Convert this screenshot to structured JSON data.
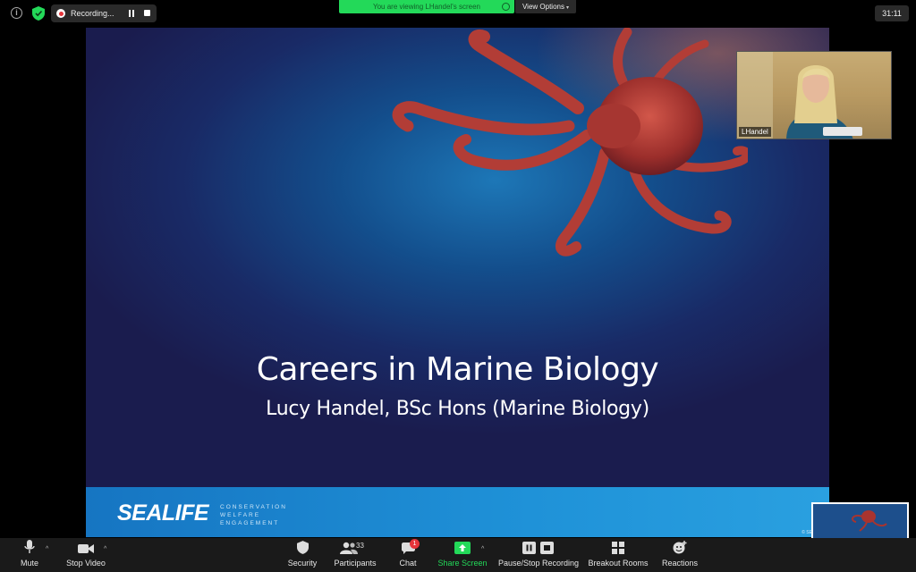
{
  "topbar": {
    "recording_label": "Recording...",
    "viewing_banner": "You are viewing LHandel's screen",
    "view_options": "View Options",
    "timer": "31:11"
  },
  "slide": {
    "title": "Careers in Marine Biology",
    "subtitle": "Lucy Handel, BSc Hons (Marine Biology)",
    "logo": "SEALIFE",
    "tagline": [
      "CONSERVATION",
      "WELFARE",
      "ENGAGEMENT"
    ],
    "copyright": "© SEA LIFE"
  },
  "video": {
    "participant_name": "LHandel"
  },
  "toolbar": {
    "mute": "Mute",
    "stop_video": "Stop Video",
    "security": "Security",
    "participants": "Participants",
    "participants_count": "33",
    "chat": "Chat",
    "chat_badge": "1",
    "share_screen": "Share Screen",
    "pause_stop_recording": "Pause/Stop Recording",
    "breakout_rooms": "Breakout Rooms",
    "reactions": "Reactions"
  },
  "colors": {
    "accent_green": "#23d959",
    "record_red": "#e5353b",
    "toolbar_bg": "#1a1a1a"
  }
}
